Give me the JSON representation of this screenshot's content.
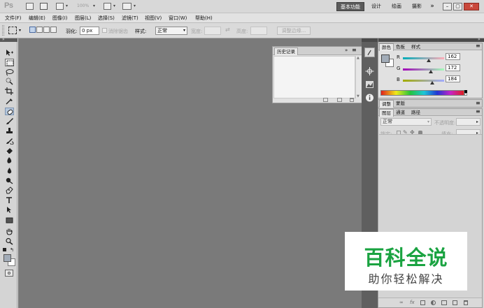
{
  "app": {
    "logo": "Ps"
  },
  "topbar": {
    "zoom": "100%",
    "workspaces": [
      {
        "label": "基本功能",
        "active": true
      },
      {
        "label": "设计"
      },
      {
        "label": "绘画"
      },
      {
        "label": "摄影"
      }
    ],
    "more": "»",
    "window_buttons": {
      "minimize": "–",
      "restore": "▢",
      "close": "✕"
    }
  },
  "menubar": {
    "items": [
      "文件(F)",
      "编辑(E)",
      "图像(I)",
      "图层(L)",
      "选择(S)",
      "滤镜(T)",
      "视图(V)",
      "窗口(W)",
      "帮助(H)"
    ]
  },
  "options": {
    "feather_label": "羽化:",
    "feather_value": "0 px",
    "antialias_label": "消除锯齿",
    "style_label": "样式:",
    "style_value": "正常",
    "width_label": "宽度:",
    "height_label": "高度:",
    "refine_label": "调整边缘..."
  },
  "tools": [
    "move-tool",
    "marquee-tool",
    "lasso-tool",
    "quick-select-tool",
    "crop-tool",
    "eyedropper-tool",
    "healing-brush-tool",
    "brush-tool",
    "clone-stamp-tool",
    "history-brush-tool",
    "eraser-tool",
    "gradient-tool",
    "blur-tool",
    "dodge-tool",
    "pen-tool",
    "type-tool",
    "path-select-tool",
    "shape-tool",
    "hand-tool",
    "zoom-tool"
  ],
  "history_panel": {
    "tab_label": "历史记录",
    "menu_icon": "»",
    "close_icon": "×"
  },
  "color_panel": {
    "tabs": [
      "颜色",
      "色板",
      "样式"
    ],
    "foreground_color": "#a2acb8",
    "background_color": "#ffffff",
    "channels": [
      {
        "label": "R",
        "value": "162",
        "fraction": 0.635,
        "gradient": "linear-gradient(90deg,#00acb8,#ffacb8)"
      },
      {
        "label": "G",
        "value": "172",
        "fraction": 0.675,
        "gradient": "linear-gradient(90deg,#a200b8,#a2ffb8)"
      },
      {
        "label": "B",
        "value": "184",
        "fraction": 0.72,
        "gradient": "linear-gradient(90deg,#a2ac00,#a2acff)"
      }
    ]
  },
  "adjust_panel": {
    "tabs": [
      "调整",
      "蒙版"
    ]
  },
  "layers_panel": {
    "tabs": [
      "图层",
      "通道",
      "路径"
    ],
    "blend_mode": "正常",
    "opacity_label": "不透明度:",
    "lock_label": "锁定:",
    "fill_label": "填充:"
  },
  "watermark": {
    "title": "百科全说",
    "subtitle": "助你轻松解决"
  },
  "colors": {
    "canvas": "#7a7a7a",
    "icon_strip": "#5f5f5f",
    "accent": "#1aa341"
  }
}
